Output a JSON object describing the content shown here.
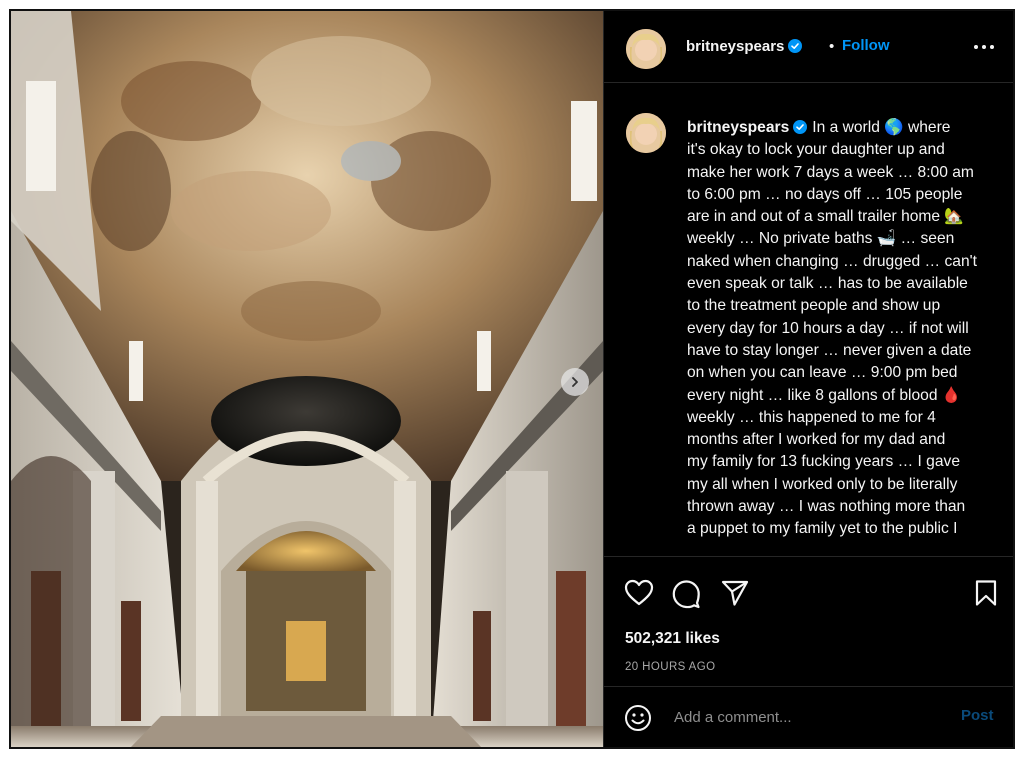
{
  "post": {
    "username": "britneyspears",
    "separator": "•",
    "follow_label": "Follow",
    "more_icon": "more-horizontal-icon",
    "caption_lines": [
      "In a world 🌎 where",
      "it's okay to lock your daughter up and",
      "make her work 7 days a week … 8:00 am",
      "to 6:00 pm … no days off … 105 people",
      "are in and out of a small trailer home 🏡",
      "weekly … No private baths 🛁 … seen",
      "naked when changing … drugged … can't",
      "even speak or talk … has to be available",
      "to the treatment people and show up",
      "every day for 10 hours a day … if not will",
      "have to stay longer … never given a date",
      "on when you can leave … 9:00 pm bed",
      "every night … like 8 gallons of blood 🩸",
      "weekly … this happened to me for 4",
      "months after I worked for my dad and",
      "my family for 13 fucking years … I gave",
      "my all when I worked only to be literally",
      "thrown away … I was nothing more than",
      "a puppet to my family yet to the public I"
    ],
    "likes": "502,321 likes",
    "timestamp": "20 HOURS AGO",
    "comment_placeholder": "Add a comment...",
    "post_label": "Post"
  },
  "icons": {
    "like": "heart-icon",
    "comment": "comment-bubble-icon",
    "share": "paper-plane-icon",
    "save": "bookmark-icon",
    "emoji": "smiley-icon",
    "next": "chevron-right-icon"
  },
  "colors": {
    "background": "#000000",
    "text": "#f5f5f5",
    "link": "#0095f6",
    "muted": "#a8a8a8",
    "divider": "#262626"
  }
}
